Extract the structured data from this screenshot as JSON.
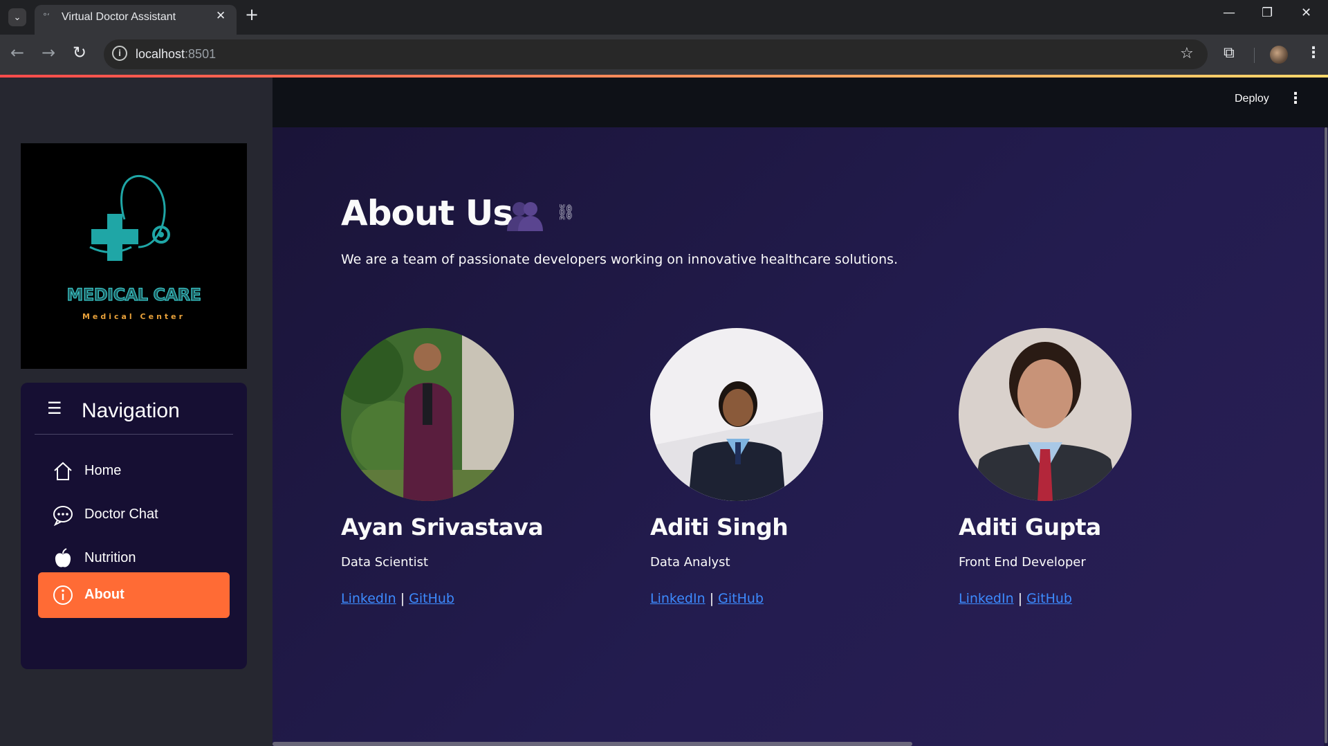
{
  "browser": {
    "tab_title": "Virtual Doctor Assistant",
    "url_host": "localhost",
    "url_port": ":8501"
  },
  "header": {
    "deploy_label": "Deploy"
  },
  "sidebar": {
    "logo_title": "MEDICAL CARE",
    "logo_subtitle": "Medical Center",
    "nav_title": "Navigation",
    "items": [
      {
        "label": "Home",
        "icon": "home-icon",
        "active": false
      },
      {
        "label": "Doctor Chat",
        "icon": "chat-icon",
        "active": false
      },
      {
        "label": "Nutrition",
        "icon": "apple-icon",
        "active": false
      },
      {
        "label": "About",
        "icon": "info-icon",
        "active": true
      }
    ]
  },
  "main": {
    "title": "About Us",
    "intro": "We are a team of passionate developers working on innovative healthcare solutions.",
    "team": [
      {
        "name": "Ayan Srivastava",
        "role": "Data Scientist",
        "linkedin": "LinkedIn",
        "github": "GitHub",
        "separator": "|"
      },
      {
        "name": "Aditi Singh",
        "role": "Data Analyst",
        "linkedin": "LinkedIn",
        "github": "GitHub",
        "separator": "|"
      },
      {
        "name": "Aditi Gupta",
        "role": "Front End Developer",
        "linkedin": "LinkedIn",
        "github": "GitHub",
        "separator": "|"
      }
    ]
  },
  "colors": {
    "active_nav": "#ff6b35",
    "link": "#3d8bff",
    "nav_panel": "#160f33",
    "logo_teal": "#37c7c9",
    "logo_orange": "#e8a13a"
  }
}
